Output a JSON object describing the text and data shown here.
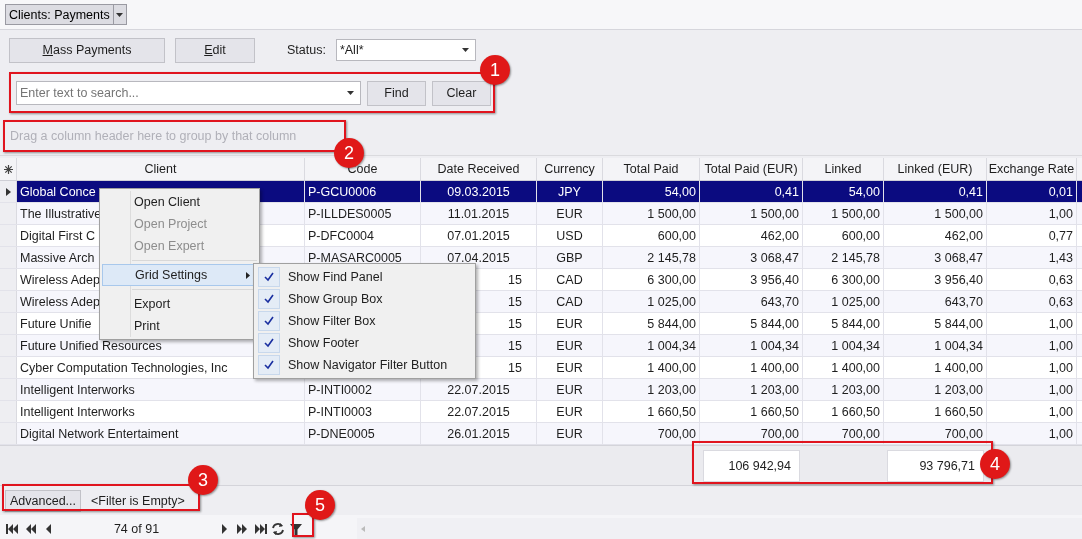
{
  "document_tab": {
    "label": "Clients: Payments"
  },
  "toolbar": {
    "buttons": [
      {
        "access_key": "M",
        "label_rest": "ass Payments"
      },
      {
        "access_key": "E",
        "label_rest": "dit"
      }
    ],
    "status_label": "Status:",
    "status_value": "*All*"
  },
  "find_panel": {
    "placeholder": "Enter text to search...",
    "buttons": [
      "Find",
      "Clear"
    ]
  },
  "group_box": {
    "hint": "Drag a column header here to group by that column"
  },
  "table": {
    "columns": [
      "Client",
      "Code",
      "Date Received",
      "Currency",
      "Total Paid",
      "Total Paid (EUR)",
      "Linked",
      "Linked (EUR)",
      "Exchange Rate"
    ],
    "rows": [
      {
        "selected": true,
        "covered_by_menu": false,
        "cells": [
          "Global Conce",
          "P-GCU0006",
          "09.03.2015",
          "JPY",
          "54,00",
          "0,41",
          "54,00",
          "0,41",
          "0,01"
        ]
      },
      {
        "selected": false,
        "covered_by_menu": false,
        "cells": [
          "The Illustrative",
          "P-ILLDES0005",
          "11.01.2015",
          "EUR",
          "1 500,00",
          "1 500,00",
          "1 500,00",
          "1 500,00",
          "1,00"
        ]
      },
      {
        "selected": false,
        "covered_by_menu": false,
        "cells": [
          "Digital First C",
          "P-DFC0004",
          "07.01.2015",
          "USD",
          "600,00",
          "462,00",
          "600,00",
          "462,00",
          "0,77"
        ]
      },
      {
        "selected": false,
        "covered_by_menu": false,
        "cells": [
          "Massive Arch",
          "P-MASARC0005",
          "07.04.2015",
          "GBP",
          "2 145,78",
          "3 068,47",
          "2 145,78",
          "3 068,47",
          "1,43"
        ]
      },
      {
        "selected": false,
        "covered_by_menu": true,
        "cells": [
          "Wireless Adep",
          null,
          "15",
          "CAD",
          "6 300,00",
          "3 956,40",
          "6 300,00",
          "3 956,40",
          "0,63"
        ]
      },
      {
        "selected": false,
        "covered_by_menu": true,
        "cells": [
          "Wireless Adep",
          null,
          "15",
          "CAD",
          "1 025,00",
          "643,70",
          "1 025,00",
          "643,70",
          "0,63"
        ]
      },
      {
        "selected": false,
        "covered_by_menu": true,
        "cells": [
          "Future Unifie",
          null,
          "15",
          "EUR",
          "5 844,00",
          "5 844,00",
          "5 844,00",
          "5 844,00",
          "1,00"
        ]
      },
      {
        "selected": false,
        "covered_by_menu": true,
        "cells": [
          "Future Unified Resources",
          null,
          "15",
          "EUR",
          "1 004,34",
          "1 004,34",
          "1 004,34",
          "1 004,34",
          "1,00"
        ]
      },
      {
        "selected": false,
        "covered_by_menu": true,
        "cells": [
          "Cyber Computation Technologies, Inc",
          null,
          "15",
          "EUR",
          "1 400,00",
          "1 400,00",
          "1 400,00",
          "1 400,00",
          "1,00"
        ]
      },
      {
        "selected": false,
        "covered_by_menu": false,
        "cells": [
          "Intelligent Interworks",
          "P-INTI0002",
          "22.07.2015",
          "EUR",
          "1 203,00",
          "1 203,00",
          "1 203,00",
          "1 203,00",
          "1,00"
        ]
      },
      {
        "selected": false,
        "covered_by_menu": false,
        "cells": [
          "Intelligent Interworks",
          "P-INTI0003",
          "22.07.2015",
          "EUR",
          "1 660,50",
          "1 660,50",
          "1 660,50",
          "1 660,50",
          "1,00"
        ]
      },
      {
        "selected": false,
        "covered_by_menu": false,
        "cells": [
          "Digital Network Entertaiment",
          "P-DNE0005",
          "26.01.2015",
          "EUR",
          "700,00",
          "700,00",
          "700,00",
          "700,00",
          "1,00"
        ]
      }
    ],
    "footer": {
      "total_paid_eur": "106 942,94",
      "linked_eur": "93 796,71"
    }
  },
  "filter_panel": {
    "button": "Advanced...",
    "text": "<Filter is Empty>"
  },
  "navigator": {
    "position": "74 of 91"
  },
  "context_menu": {
    "items": [
      {
        "kind": "item",
        "label": "Open Client",
        "disabled": false,
        "highlighted": false
      },
      {
        "kind": "item",
        "label": "Open Project",
        "disabled": true,
        "highlighted": false
      },
      {
        "kind": "item",
        "label": "Open Expert",
        "disabled": true,
        "highlighted": false
      },
      {
        "kind": "separator"
      },
      {
        "kind": "submenu",
        "label": "Grid Settings",
        "disabled": false,
        "highlighted": true
      },
      {
        "kind": "separator"
      },
      {
        "kind": "item",
        "label": "Export",
        "disabled": false,
        "highlighted": false
      },
      {
        "kind": "item",
        "label": "Print",
        "disabled": false,
        "highlighted": false
      }
    ],
    "submenu": [
      {
        "label": "Show Find Panel",
        "checked": true
      },
      {
        "label": "Show Group Box",
        "checked": true
      },
      {
        "label": "Show Filter Box",
        "checked": true
      },
      {
        "label": "Show Footer",
        "checked": true
      },
      {
        "label": "Show Navigator Filter Button",
        "checked": true
      }
    ]
  },
  "callouts": [
    {
      "number": "1"
    },
    {
      "number": "2"
    },
    {
      "number": "3"
    },
    {
      "number": "4"
    },
    {
      "number": "5"
    }
  ]
}
